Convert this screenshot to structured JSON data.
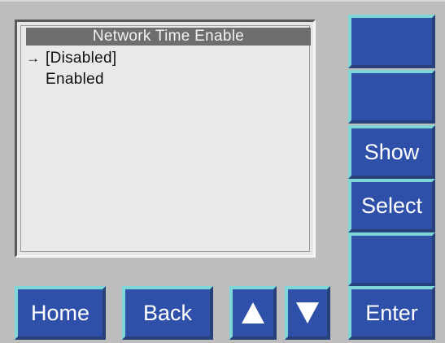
{
  "screen": {
    "title": "Network Time Enable",
    "selector_glyph": "→",
    "options": [
      "[Disabled]",
      "Enabled"
    ]
  },
  "side_buttons": [
    {
      "label": ""
    },
    {
      "label": ""
    },
    {
      "label": "Show"
    },
    {
      "label": "Select"
    },
    {
      "label": ""
    },
    {
      "label": "Enter"
    }
  ],
  "bottom_buttons": {
    "home": "Home",
    "back": "Back",
    "up_icon": "up-triangle",
    "down_icon": "down-triangle"
  },
  "colors": {
    "button_face": "#2f50a8",
    "button_highlight": "#7fd6d6",
    "panel": "#bdbdbd",
    "screen": "#e9e9e9",
    "title_bar": "#6e6e6e"
  }
}
